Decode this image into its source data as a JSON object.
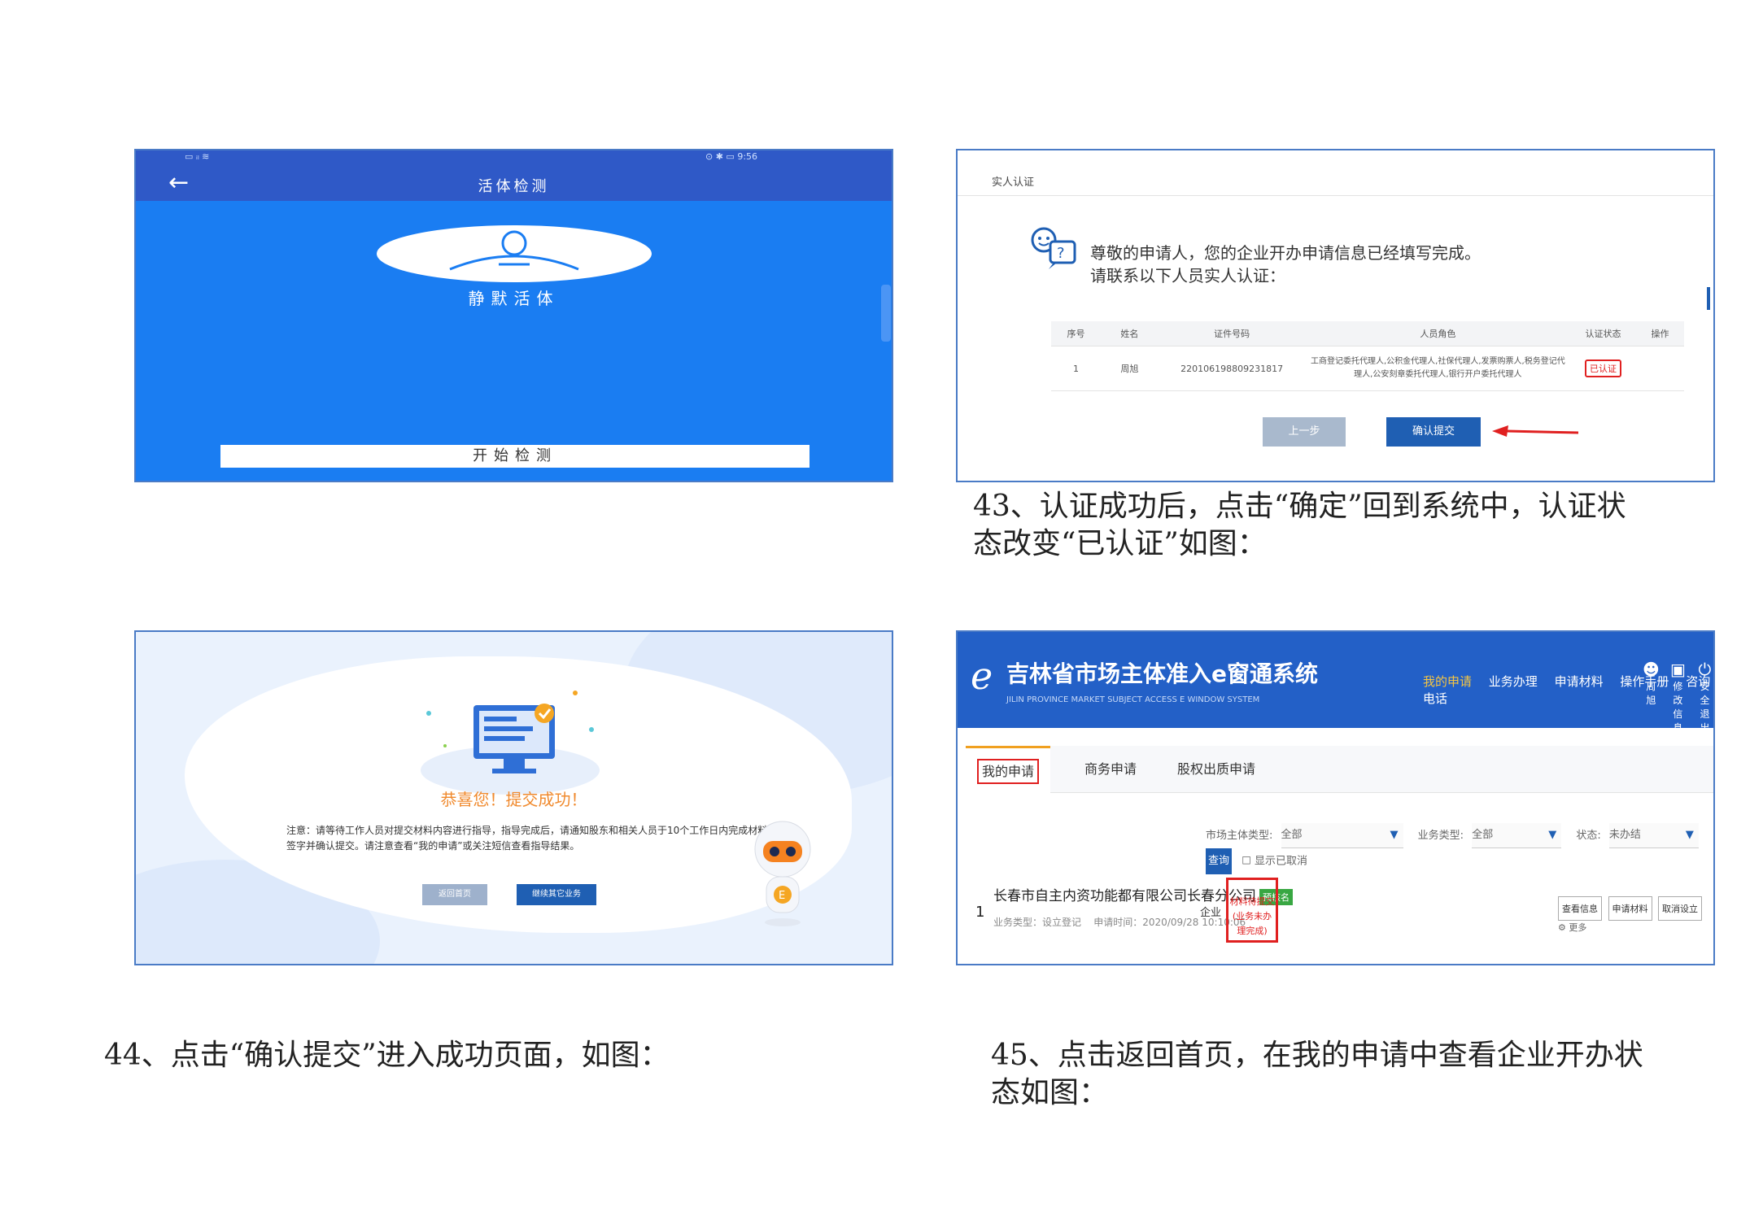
{
  "panel1": {
    "title": "活体检测",
    "mode": "静默活体",
    "start_button": "开始检测",
    "status_left": "▭ ᵢₗ ≋",
    "status_right": "⊙ ✱ ▭ 9:56"
  },
  "panel2": {
    "header": "实人认证",
    "message_line1": "尊敬的申请人，您的企业开办申请信息已经填写完成。",
    "message_line2": "请联系以下人员实人认证：",
    "columns": [
      "序号",
      "姓名",
      "证件号码",
      "人员角色",
      "认证状态",
      "操作"
    ],
    "row": {
      "index": "1",
      "name": "周旭",
      "id_number": "220106198809231817",
      "role": "工商登记委托代理人,公积金代理人,社保代理人,发票购票人,税务登记代理人,公安刻章委托代理人,银行开户委托代理人",
      "status": "已认证",
      "action": ""
    },
    "prev_button": "上一步",
    "confirm_button": "确认提交"
  },
  "caption43": {
    "line1": "43、认证成功后，点击“确定”回到系统中，认证状",
    "line2": "态改变“已认证”如图："
  },
  "panel3": {
    "congrats": "恭喜您！提交成功！",
    "note_line1": "注意：请等待工作人员对提交材料内容进行指导，指导完成后，请通知股东和相关人员于10个工作日内完成材料",
    "note_line2": "签字并确认提交。请注意查看“我的申请”或关注短信查看指导结果。",
    "home_button": "返回首页",
    "continue_button": "继续其它业务"
  },
  "panel4": {
    "system_name": "吉林省市场主体准入e窗通系统",
    "system_sub": "JILIN PROVINCE MARKET SUBJECT ACCESS E WINDOW SYSTEM",
    "nav": [
      "我的申请",
      "业务办理",
      "申请材料",
      "操作手册",
      "咨询电话"
    ],
    "top_icons": [
      "周旭",
      "修改信息",
      "安全退出"
    ],
    "tabs": [
      "我的申请",
      "商务申请",
      "股权出质申请"
    ],
    "filter_type_label": "市场主体类型:",
    "filter_type_value": "全部",
    "filter_biz_label": "业务类型:",
    "filter_biz_value": "全部",
    "filter_status_label": "状态:",
    "filter_status_value": "未办结",
    "search_button": "查询",
    "show_cancelled": "显示已取消",
    "row_index": "1",
    "company": "长春市自主内资功能都有限公司长春分公司",
    "badge": "预核名",
    "business_type": "业务类型：设立登记",
    "apply_time": "申请时间：2020/09/28 10:10:06",
    "entity_type": "企业",
    "status_line1": "材料待提交",
    "status_line2": "(业务未办理完成)",
    "actions": [
      "查看信息",
      "申请材料",
      "取消设立",
      "更多"
    ]
  },
  "caption44": "44、点击“确认提交”进入成功页面，如图：",
  "caption45": {
    "line1": "45、点击返回首页，在我的申请中查看企业开办状",
    "line2": "态如图："
  },
  "colors": {
    "phone_blue": "#1a7df2",
    "system_blue": "#2360c7",
    "button_blue": "#1f5fb3",
    "alert_red": "#e02020",
    "congrats_orange": "#f08a2e"
  }
}
